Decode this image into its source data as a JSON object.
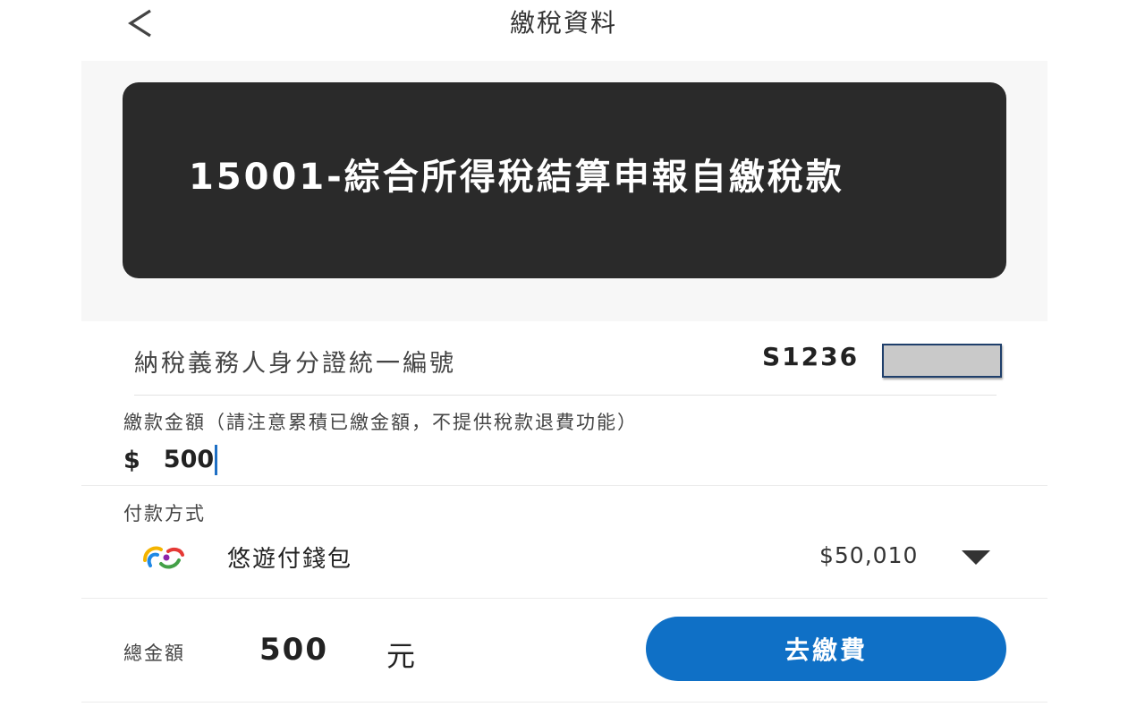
{
  "header": {
    "back_icon": "chevron-left-icon",
    "title": "繳稅資料"
  },
  "tax_card": {
    "title": "15001-綜合所得稅結算申報自繳稅款"
  },
  "taxpayer_id": {
    "label": "納稅義務人身分證統一編號",
    "value_visible": "S1236"
  },
  "amount": {
    "label": "繳款金額（請注意累積已繳金額，不提供稅款退費功能）",
    "currency_symbol": "$",
    "value": "500"
  },
  "payment_method": {
    "label": "付款方式",
    "wallet_icon": "easywallet-logo-icon",
    "wallet_name": "悠遊付錢包",
    "balance": "$50,010",
    "dropdown_icon": "caret-down-icon"
  },
  "footer": {
    "total_label": "總金額",
    "total_value": "500",
    "total_unit": "元",
    "pay_button_label": "去繳費"
  },
  "colors": {
    "accent": "#0f70c6",
    "card_bg": "#2a2a2a",
    "band_bg": "#f7f7f7"
  }
}
